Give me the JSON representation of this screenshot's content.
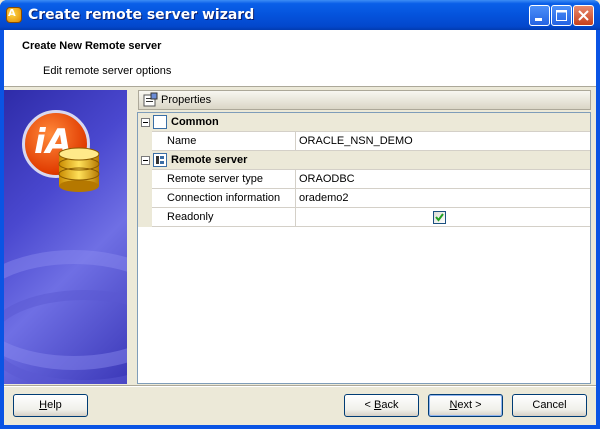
{
  "window": {
    "title": "Create remote server wizard",
    "app_icon": "iA-app-icon"
  },
  "header": {
    "title": "Create New Remote server",
    "subtitle": "Edit remote server options"
  },
  "properties": {
    "panel_title": "Properties",
    "categories": [
      {
        "label": "Common",
        "expanded": true,
        "rows": [
          {
            "name": "Name",
            "value": "ORACLE_NSN_DEMO"
          }
        ]
      },
      {
        "label": "Remote server",
        "expanded": true,
        "rows": [
          {
            "name": "Remote server type",
            "value": "ORAODBC"
          },
          {
            "name": "Connection information",
            "value": "orademo2"
          },
          {
            "name": "Readonly",
            "value": "",
            "checked": true
          }
        ]
      }
    ]
  },
  "buttons": {
    "help": {
      "accel": "H",
      "rest": "elp"
    },
    "back": {
      "prefix": "< ",
      "accel": "B",
      "rest": "ack"
    },
    "next": {
      "accel": "N",
      "rest": "ext >"
    },
    "cancel": "Cancel"
  },
  "colors": {
    "titlebar": "#0453dc",
    "face": "#ece9d8",
    "banner": "#4a48cf",
    "check": "#21a121"
  }
}
